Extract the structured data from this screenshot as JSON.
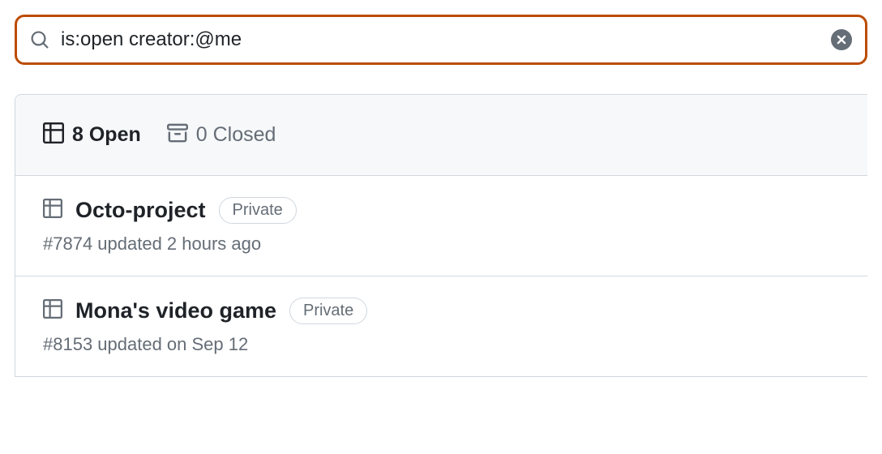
{
  "search": {
    "value": "is:open creator:@me"
  },
  "tabs": {
    "open": {
      "count": 8,
      "label": "8 Open"
    },
    "closed": {
      "count": 0,
      "label": "0 Closed"
    }
  },
  "projects": [
    {
      "title": "Octo-project",
      "badge": "Private",
      "meta": "#7874 updated 2 hours ago"
    },
    {
      "title": "Mona's video game",
      "badge": "Private",
      "meta": "#8153 updated on Sep 12"
    }
  ]
}
